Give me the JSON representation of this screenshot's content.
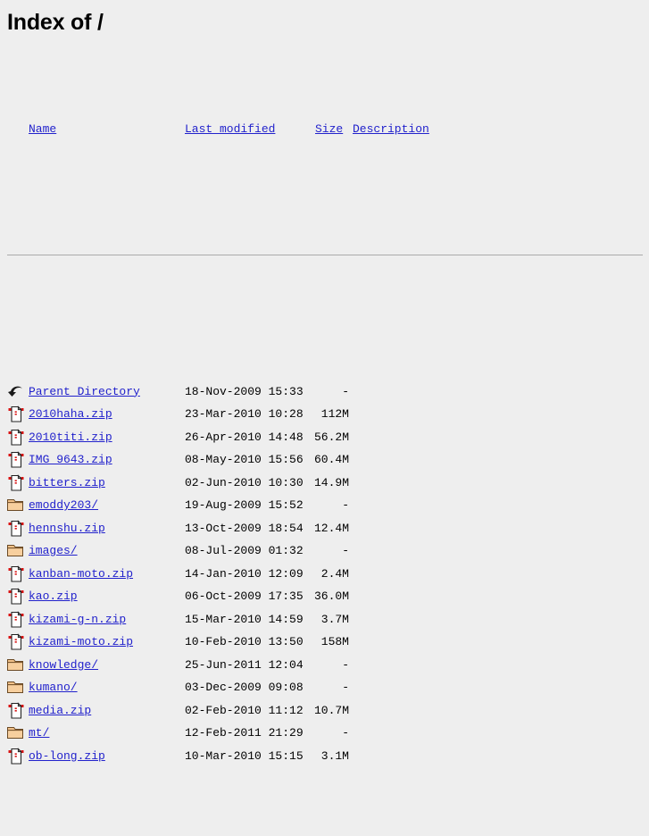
{
  "page": {
    "title_prefix": "Index of ",
    "title_path": "/",
    "background_color": "#eeeeee",
    "link_color": "#2222cc",
    "rule_color": "#aaaaaa"
  },
  "columns": {
    "name": "Name",
    "last_modified": "Last modified",
    "size": "Size",
    "description": "Description"
  },
  "rows": [
    {
      "icon": "parent-directory-icon",
      "name": "Parent Directory",
      "last_modified": "18-Nov-2009 15:33",
      "size": "-",
      "description": ""
    },
    {
      "icon": "compressed-file-icon",
      "name": "2010haha.zip",
      "last_modified": "23-Mar-2010 10:28",
      "size": "112M",
      "description": ""
    },
    {
      "icon": "compressed-file-icon",
      "name": "2010titi.zip",
      "last_modified": "26-Apr-2010 14:48",
      "size": "56.2M",
      "description": ""
    },
    {
      "icon": "compressed-file-icon",
      "name": "IMG 9643.zip",
      "last_modified": "08-May-2010 15:56",
      "size": "60.4M",
      "description": ""
    },
    {
      "icon": "compressed-file-icon",
      "name": "bitters.zip",
      "last_modified": "02-Jun-2010 10:30",
      "size": "14.9M",
      "description": ""
    },
    {
      "icon": "folder-icon",
      "name": "emoddy203/",
      "last_modified": "19-Aug-2009 15:52",
      "size": "-",
      "description": ""
    },
    {
      "icon": "compressed-file-icon",
      "name": "hennshu.zip",
      "last_modified": "13-Oct-2009 18:54",
      "size": "12.4M",
      "description": ""
    },
    {
      "icon": "folder-icon",
      "name": "images/",
      "last_modified": "08-Jul-2009 01:32",
      "size": "-",
      "description": ""
    },
    {
      "icon": "compressed-file-icon",
      "name": "kanban-moto.zip",
      "last_modified": "14-Jan-2010 12:09",
      "size": "2.4M",
      "description": ""
    },
    {
      "icon": "compressed-file-icon",
      "name": "kao.zip",
      "last_modified": "06-Oct-2009 17:35",
      "size": "36.0M",
      "description": ""
    },
    {
      "icon": "compressed-file-icon",
      "name": "kizami-g-n.zip",
      "last_modified": "15-Mar-2010 14:59",
      "size": "3.7M",
      "description": ""
    },
    {
      "icon": "compressed-file-icon",
      "name": "kizami-moto.zip",
      "last_modified": "10-Feb-2010 13:50",
      "size": "158M",
      "description": ""
    },
    {
      "icon": "folder-icon",
      "name": "knowledge/",
      "last_modified": "25-Jun-2011 12:04",
      "size": "-",
      "description": ""
    },
    {
      "icon": "folder-icon",
      "name": "kumano/",
      "last_modified": "03-Dec-2009 09:08",
      "size": "-",
      "description": ""
    },
    {
      "icon": "compressed-file-icon",
      "name": "media.zip",
      "last_modified": "02-Feb-2010 11:12",
      "size": "10.7M",
      "description": ""
    },
    {
      "icon": "folder-icon",
      "name": "mt/",
      "last_modified": "12-Feb-2011 21:29",
      "size": "-",
      "description": ""
    },
    {
      "icon": "compressed-file-icon",
      "name": "ob-long.zip",
      "last_modified": "10-Mar-2010 15:15",
      "size": "3.1M",
      "description": ""
    }
  ]
}
